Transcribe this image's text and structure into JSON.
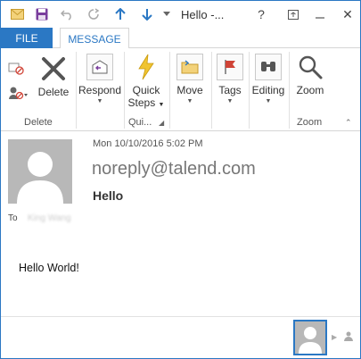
{
  "titlebar": {
    "title": "Hello -...",
    "icons": [
      "mail-icon",
      "save-icon",
      "undo-icon",
      "redo-icon",
      "up-arrow-icon",
      "down-arrow-icon"
    ],
    "help": "?",
    "close": "✕"
  },
  "tabs": {
    "file": "FILE",
    "message": "MESSAGE"
  },
  "ribbon": {
    "delete_group": {
      "delete_label": "Delete",
      "group_label": "Delete"
    },
    "respond_label": "Respond",
    "quick_steps": {
      "line1": "Quick",
      "line2": "Steps",
      "group_label": "Qui..."
    },
    "move_label": "Move",
    "tags_label": "Tags",
    "editing_label": "Editing",
    "zoom": {
      "zoom_label": "Zoom",
      "group_label": "Zoom"
    }
  },
  "message": {
    "date": "Mon 10/10/2016 5:02 PM",
    "sender": "noreply@talend.com",
    "subject": "Hello",
    "to_label": "To",
    "to_names": "King Wang",
    "body": "Hello World!"
  },
  "colors": {
    "accent": "#2b78c4",
    "avatar": "#b8b8b8"
  }
}
